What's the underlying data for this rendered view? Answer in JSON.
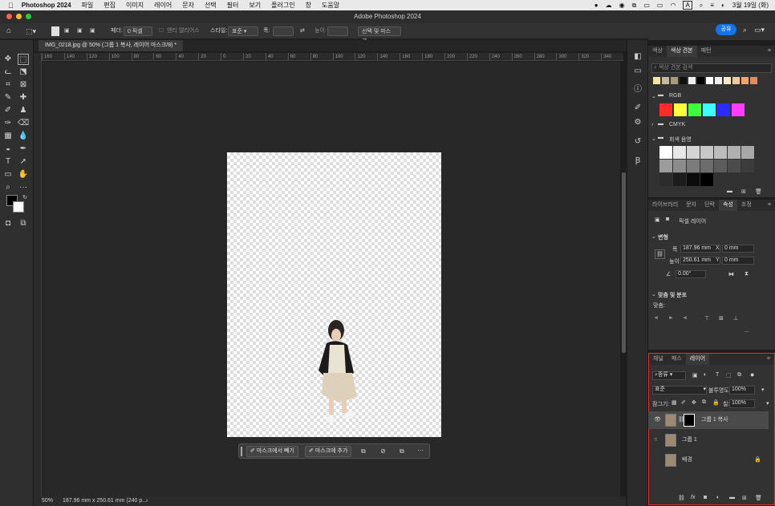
{
  "menubar": {
    "app_name": "Photoshop 2024",
    "items": [
      "파일",
      "편집",
      "이미지",
      "레이어",
      "문자",
      "선택",
      "필터",
      "보기",
      "플러그인",
      "창",
      "도움말"
    ],
    "clock": "3월 19일 (화)"
  },
  "window": {
    "title": "Adobe Photoshop 2024"
  },
  "options": {
    "feather_label": "페더:",
    "feather_value": "0 픽셀",
    "antialias_label": "앤티 앨리어스",
    "style_label": "스타일:",
    "style_value": "표준",
    "width_label": "폭:",
    "height_label": "높이:",
    "select_mask_button": "선택 및 마스크...",
    "share_button": "공유"
  },
  "document": {
    "tab_title": "IMG_0218.jpg @ 50% (그룹 1 복사, 레이어 마스크/8) *",
    "ruler_ticks": [
      "160",
      "140",
      "120",
      "100",
      "80",
      "60",
      "40",
      "20",
      "0",
      "20",
      "40",
      "60",
      "80",
      "100",
      "120",
      "140",
      "160",
      "180",
      "200",
      "220",
      "240",
      "260",
      "280",
      "300",
      "320",
      "340"
    ],
    "zoom": "50%",
    "doc_info": "187.96 mm x 250.61 mm (240 p..."
  },
  "context_bar": {
    "subtract_mask": "마스크에서 빼기",
    "add_mask": "마스크에 추가"
  },
  "swatches_panel": {
    "tabs": [
      "색상",
      "색상 견본",
      "패턴"
    ],
    "search_placeholder": "색상 견본 검색",
    "recent": [
      "#f5e6a3",
      "#c8b99a",
      "#a99b82",
      "#111111",
      "#f0f0f0",
      "#000000",
      "#ffffff",
      "#eeeeee",
      "#f4e9c8",
      "#f3c99a",
      "#f0a36b",
      "#e98a52"
    ],
    "group_rgb": "RGB",
    "rgb_colors": [
      "#ff2b2b",
      "#ffff3b",
      "#3bff3b",
      "#3bffff",
      "#2b2bff",
      "#ff3bff"
    ],
    "group_cmyk": "CMYK",
    "group_gray": "회색 음영",
    "gray_colors": [
      "#ffffff",
      "#e8e8e8",
      "#d4d4d4",
      "#c8c8c8",
      "#bcbcbc",
      "#b0b0b0",
      "#a8a8a8",
      "#9c9c9c",
      "#8c8c8c",
      "#7c7c7c",
      "#6c6c6c",
      "#5c5c5c",
      "#4c4c4c",
      "#3c3c3c",
      "#2c2c2c",
      "#1c1c1c",
      "#0c0c0c",
      "#000000"
    ]
  },
  "properties_panel": {
    "tabs": [
      "라이브러리",
      "문자",
      "단락",
      "속성",
      "조정"
    ],
    "kind": "픽셀 레이어",
    "transform_heading": "변형",
    "w_label": "폭",
    "w_value": "187.96 mm",
    "x_label": "X",
    "x_value": "0 mm",
    "h_label": "높이",
    "h_value": "250.61 mm",
    "y_label": "Y",
    "y_value": "0 mm",
    "angle_value": "0.00°",
    "align_heading": "맞춤 및 분포",
    "align_label": "맞춤:",
    "more": "..."
  },
  "layers_panel": {
    "tabs": [
      "채널",
      "패스",
      "레이어"
    ],
    "kind_label": "종류",
    "blend_mode": "표준",
    "opacity_label": "불투명도:",
    "opacity_value": "100%",
    "lock_label": "잠그기:",
    "fill_label": "칠:",
    "fill_value": "100%",
    "layers": [
      {
        "name": "그룹 1 복사"
      },
      {
        "name": "그룹 1"
      },
      {
        "name": "배경"
      }
    ]
  }
}
